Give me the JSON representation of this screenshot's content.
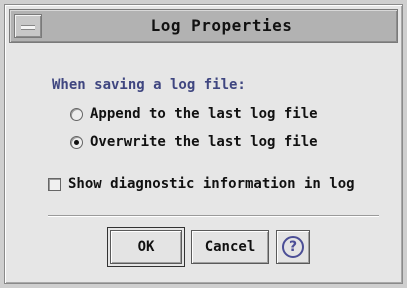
{
  "window": {
    "title": "Log Properties"
  },
  "section": {
    "label": "When saving a log file:"
  },
  "options": {
    "append": {
      "label": "Append to the last log file",
      "selected": false
    },
    "overwrite": {
      "label": "Overwrite the last log file",
      "selected": true
    }
  },
  "diagnostic": {
    "label": "Show diagnostic information in log",
    "checked": false
  },
  "buttons": {
    "ok": "OK",
    "cancel": "Cancel",
    "help": "?"
  },
  "icons": {
    "window_menu": "window-menu-icon",
    "help": "help-icon"
  }
}
